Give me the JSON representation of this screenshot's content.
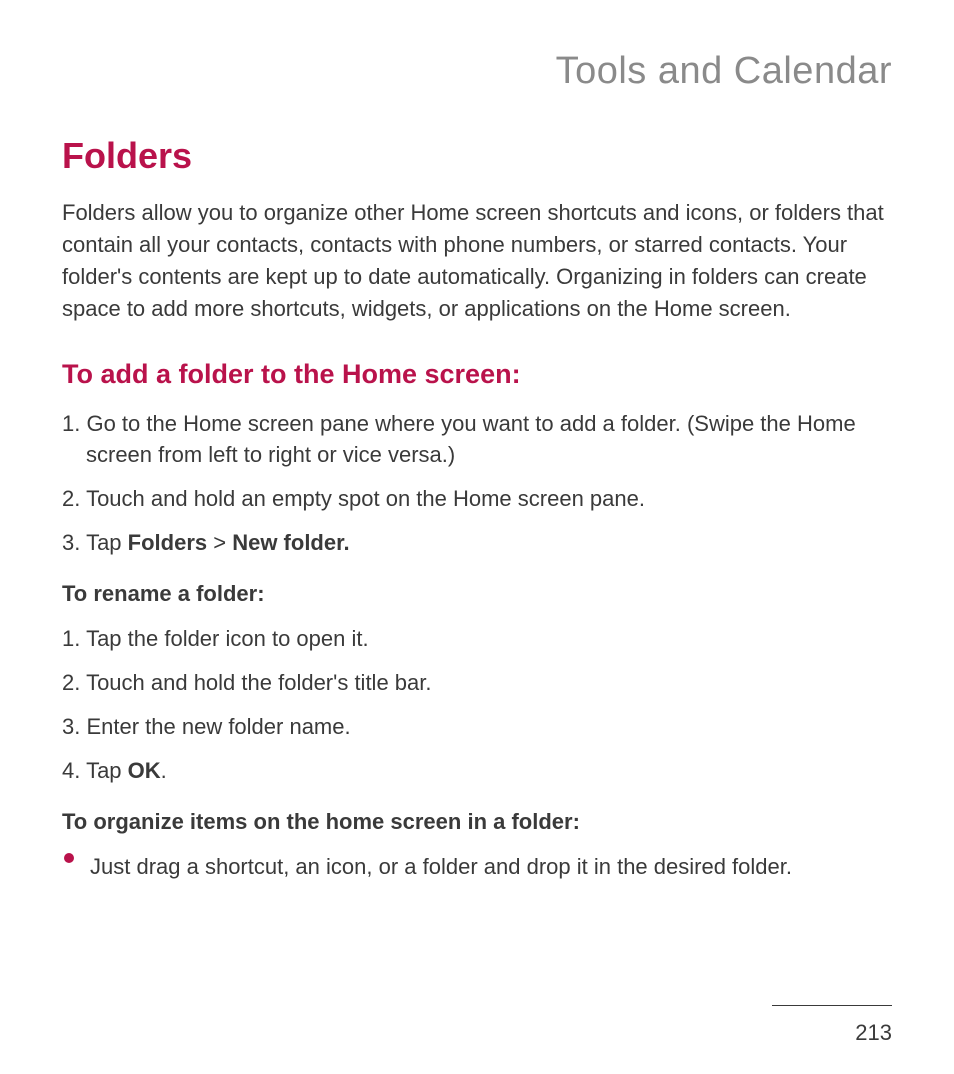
{
  "chapter": "Tools and Calendar",
  "section": "Folders",
  "intro": "Folders allow you to organize other Home screen shortcuts and icons, or folders that contain all your contacts, contacts with phone numbers, or starred contacts. Your folder's contents are kept up to date automatically. Organizing in folders can create space to add more shortcuts, widgets, or applications on the Home screen.",
  "subsection": "To add a folder to the Home screen:",
  "steps_add": {
    "s1": "1. Go to the Home screen pane where you want to add a folder. (Swipe the Home screen from left to right or vice versa.)",
    "s2": "2. Touch and hold an empty spot on the Home screen pane.",
    "s3_pre": "3. Tap ",
    "s3_b1": "Folders",
    "s3_mid": " > ",
    "s3_b2": "New folder."
  },
  "rename_heading": "To rename a folder:",
  "steps_rename": {
    "s1": "1. Tap the folder icon to open it.",
    "s2": "2. Touch and hold the folder's title bar.",
    "s3": "3. Enter the new folder name.",
    "s4_pre": "4. Tap ",
    "s4_b": "OK",
    "s4_post": "."
  },
  "organize_heading": "To organize items on the home screen in a folder:",
  "organize_bullet": "Just drag a shortcut, an icon, or a folder and drop it in the desired folder.",
  "page_number": "213"
}
